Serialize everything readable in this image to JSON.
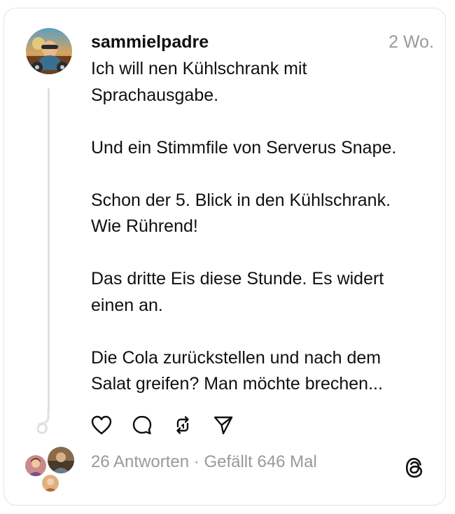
{
  "post": {
    "username": "sammielpadre",
    "timestamp": "2 Wo.",
    "lines": [
      "Ich will nen Kühlschrank mit",
      "Sprachausgabe.",
      "",
      "Und ein Stimmfile von Serverus Snape.",
      "",
      "Schon der 5. Blick in den Kühlschrank.",
      "Wie Rührend!",
      "",
      "Das dritte Eis diese Stunde. Es widert",
      "einen an.",
      "",
      "Die Cola zurückstellen und nach dem",
      "Salat greifen? Man möchte brechen..."
    ]
  },
  "actions": [
    {
      "name": "like",
      "icon": "heart-icon"
    },
    {
      "name": "reply",
      "icon": "comment-icon"
    },
    {
      "name": "repost",
      "icon": "repost-icon"
    },
    {
      "name": "share",
      "icon": "send-icon"
    }
  ],
  "stats": {
    "replies": "26 Antworten",
    "separator": " · ",
    "likes": "Gefällt 646 Mal"
  },
  "colors": {
    "text": "#101010",
    "muted": "#9a9a9a",
    "border": "#e3e3e3",
    "thread_line": "#e0e0e0"
  },
  "brand": "threads-logo-icon"
}
